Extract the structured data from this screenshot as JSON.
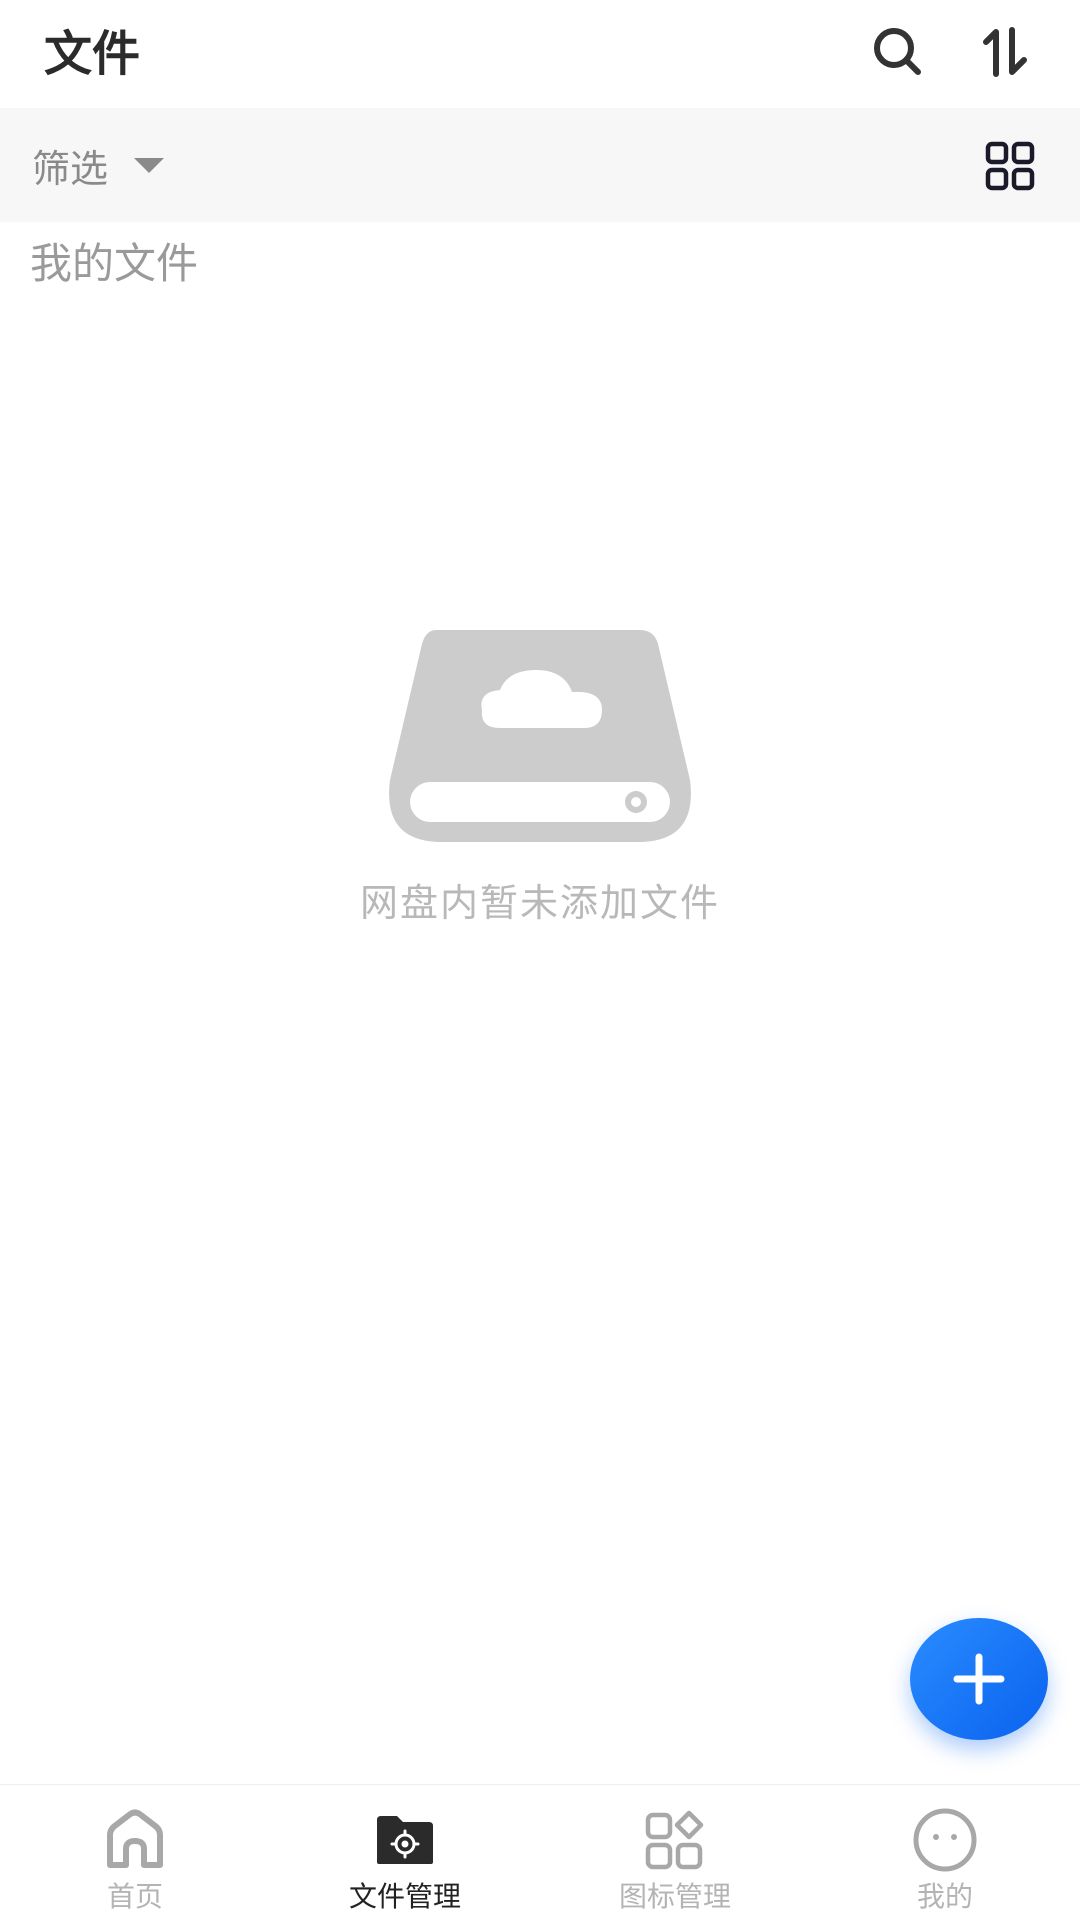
{
  "header": {
    "title": "文件",
    "search_icon": "search-icon",
    "sort_icon": "sort-icon"
  },
  "filter_bar": {
    "label": "筛选",
    "dropdown_icon": "caret-down-icon",
    "view_icon": "grid-view-icon"
  },
  "section": {
    "title": "我的文件"
  },
  "empty_state": {
    "illustration_icon": "cloud-drive-icon",
    "message": "网盘内暂未添加文件"
  },
  "fab": {
    "icon": "plus-icon",
    "color": "#1677ff"
  },
  "bottom_nav": {
    "items": [
      {
        "label": "首页",
        "icon": "home-icon",
        "active": false
      },
      {
        "label": "文件管理",
        "icon": "folder-settings-icon",
        "active": true
      },
      {
        "label": "图标管理",
        "icon": "apps-icon",
        "active": false
      },
      {
        "label": "我的",
        "icon": "profile-face-icon",
        "active": false
      }
    ]
  },
  "colors": {
    "accent": "#1677ff",
    "inactive_text": "#b4b4b4",
    "active_text": "#222222",
    "filter_bg": "#f7f7f7"
  }
}
